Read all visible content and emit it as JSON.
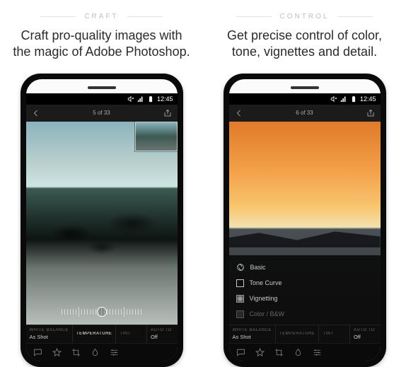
{
  "left": {
    "section": "CRAFT",
    "headline_bold": "Craft pro-quality images",
    "headline_rest": " with the magic of Adobe Photoshop.",
    "status_time": "12:45",
    "counter": "5 of 33",
    "params": [
      {
        "label": "WHITE BALANCE",
        "value": "As Shot"
      },
      {
        "label": "TEMPERATURE",
        "value": ""
      },
      {
        "label": "TINT",
        "value": ""
      },
      {
        "label": "AUTO TO",
        "value": "Off"
      }
    ],
    "active_param_index": 1
  },
  "right": {
    "section": "CONTROL",
    "headline_bold": "Get precise control",
    "headline_rest": " of color, tone, vignettes and detail.",
    "status_time": "12:45",
    "counter": "6 of 33",
    "tools": [
      {
        "name": "Basic"
      },
      {
        "name": "Tone Curve"
      },
      {
        "name": "Vignetting"
      },
      {
        "name": "Color / B&W"
      }
    ],
    "params": [
      {
        "label": "WHITE BALANCE",
        "value": "As Shot"
      },
      {
        "label": "TEMPERATURE",
        "value": ""
      },
      {
        "label": "TINT",
        "value": ""
      },
      {
        "label": "AUTO TO",
        "value": "Off"
      }
    ]
  }
}
